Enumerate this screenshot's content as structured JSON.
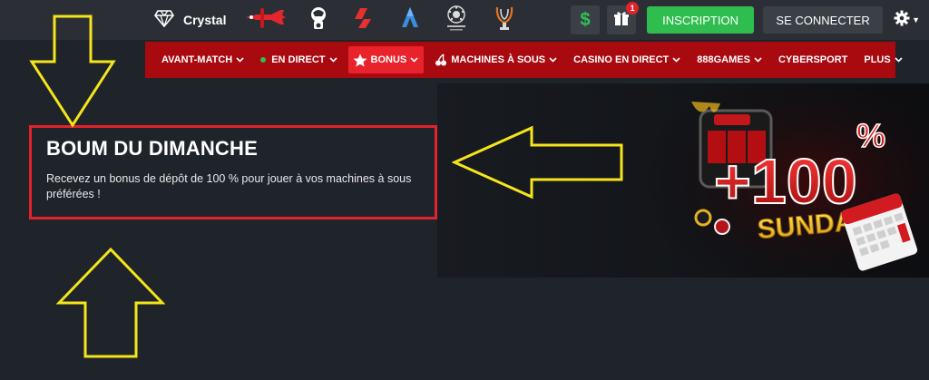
{
  "topbar": {
    "crystal_label": "Crystal",
    "gift_badge_count": "1",
    "dollar_symbol": "$",
    "inscription_label": "INSCRIPTION",
    "login_label": "SE CONNECTER"
  },
  "nav": {
    "items": [
      {
        "label": "AVANT-MATCH"
      },
      {
        "label": "EN DIRECT"
      },
      {
        "label": "BONUS"
      },
      {
        "label": "MACHINES À SOUS"
      },
      {
        "label": "CASINO EN DIRECT"
      },
      {
        "label": "888GAMES"
      },
      {
        "label": "CYBERSPORT"
      },
      {
        "label": "PLUS"
      }
    ]
  },
  "promo": {
    "title": "BOUM DU DIMANCHE",
    "description": "Recevez un bonus de dépôt de 100 % pour jouer à vos machines à sous préférées !"
  },
  "banner": {
    "plus_percent": "+100",
    "percent_sign": "%",
    "sunday": "SUNDAY"
  },
  "colors": {
    "nav_bg": "#a80a10",
    "accent_red": "#e3222b",
    "green": "#2fbd4f",
    "annotation_yellow": "#f5e51a"
  },
  "icons": [
    "diamond-icon",
    "aviator-plane-icon",
    "premier-league-icon",
    "laliga-icon",
    "serie-a-icon",
    "champions-league-icon",
    "europa-league-icon",
    "dollar-icon",
    "gift-icon",
    "gear-icon",
    "star-icon",
    "cherry-icon",
    "chevron-down-icon"
  ]
}
